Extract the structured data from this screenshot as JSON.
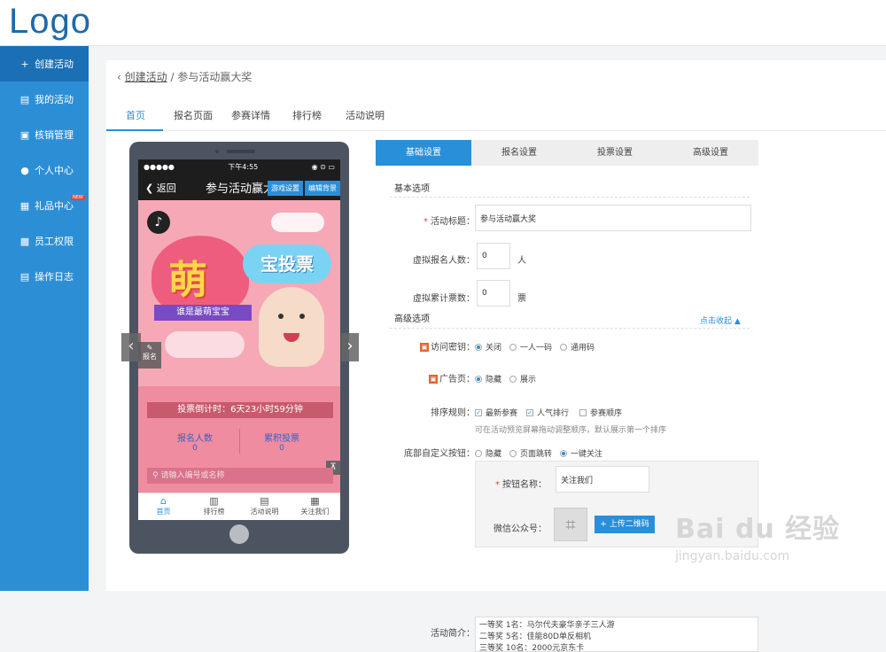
{
  "logo": "Logo",
  "sidebar": {
    "items": [
      {
        "label": "创建活动",
        "icon": "plus-icon",
        "active": true
      },
      {
        "label": "我的活动",
        "icon": "document-icon"
      },
      {
        "label": "核销管理",
        "icon": "ticket-icon"
      },
      {
        "label": "个人中心",
        "icon": "user-icon"
      },
      {
        "label": "礼品中心",
        "icon": "gift-icon",
        "badge": "NEW"
      },
      {
        "label": "员工权限",
        "icon": "lock-icon"
      },
      {
        "label": "操作日志",
        "icon": "log-icon"
      }
    ]
  },
  "breadcrumb": {
    "parent": "创建活动",
    "separator": "/",
    "current": "参与活动赢大奖"
  },
  "tabs": [
    "首页",
    "报名页面",
    "参赛详情",
    "排行榜",
    "活动说明"
  ],
  "phone": {
    "status": {
      "signal": "●●●●●",
      "time": "下午4:55",
      "right": "◉ ⊙ ▭"
    },
    "nav": {
      "back": "返回",
      "title": "参与活动赢大奖",
      "btn_game": "游戏设置",
      "btn_bg": "编辑背景"
    },
    "hero": {
      "big": "萌",
      "badge": "宝投票",
      "ribbon": "谁是最萌宝宝"
    },
    "signup": "报名",
    "countdown": "投票倒计时：6天23小时59分钟",
    "stats": [
      {
        "label": "报名人数",
        "value": "0"
      },
      {
        "label": "累积投票",
        "value": "0"
      }
    ],
    "search_placeholder": "请输入编号或名称",
    "tabbar": [
      "首页",
      "排行榜",
      "活动说明",
      "关注我们"
    ]
  },
  "settings": {
    "tabs": [
      "基础设置",
      "报名设置",
      "投票设置",
      "高级设置"
    ],
    "basic_title": "基本选项",
    "activity_title_label": "活动标题：",
    "activity_title_value": "参与活动赢大奖",
    "virtual_signups_label": "虚拟报名人数：",
    "virtual_signups_value": "0",
    "virtual_signups_unit": "人",
    "virtual_votes_label": "虚拟累计票数：",
    "virtual_votes_value": "0",
    "virtual_votes_unit": "票",
    "advanced_title": "高级选项",
    "collapse": "点击收起",
    "access_label": "访问密钥：",
    "access_options": [
      "关闭",
      "一人一码",
      "通用码"
    ],
    "ad_label": "广告页：",
    "ad_options": [
      "隐藏",
      "展示"
    ],
    "sort_label": "排序规则：",
    "sort_options": [
      "最新参赛",
      "人气排行",
      "参赛顺序"
    ],
    "sort_hint": "可在活动预览屏幕拖动调整顺序，默认展示第一个排序",
    "bottom_label": "底部自定义按钮：",
    "bottom_options": [
      "隐藏",
      "页面跳转",
      "一键关注"
    ],
    "button_name_label": "按钮名称：",
    "button_name_value": "关注我们",
    "wechat_label": "微信公众号：",
    "upload_btn": "+ 上传二维码",
    "intro_label": "活动简介：",
    "intro_lines": [
      "一等奖 1名：马尔代夫豪华亲子三人游",
      "二等奖 5名：佳能80D单反相机",
      "三等奖 10名：2000元京东卡"
    ]
  },
  "watermark": {
    "big": "Bai du 经验",
    "small": "jingyan.baidu.com"
  },
  "colors": {
    "primary": "#2a8fd9",
    "sidebar": "#2c8fd6",
    "sidebar_active": "#1b6fb5",
    "required": "#e2493b"
  }
}
